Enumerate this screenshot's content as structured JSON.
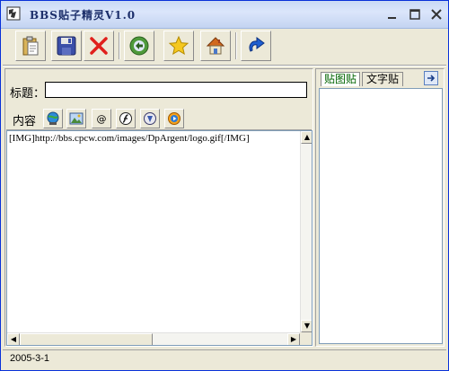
{
  "window": {
    "title": "BBS贴子精灵V1.0"
  },
  "toolbar": {
    "buttons": [
      {
        "name": "clipboard-paste",
        "icon": "clipboard-icon"
      },
      {
        "name": "save",
        "icon": "floppy-disk-icon"
      },
      {
        "name": "delete",
        "icon": "red-x-icon"
      },
      {
        "name": "go",
        "icon": "green-arrow-circle-icon"
      },
      {
        "name": "favorite",
        "icon": "star-icon"
      },
      {
        "name": "home",
        "icon": "house-icon"
      },
      {
        "name": "redo",
        "icon": "blue-redo-arrow-icon"
      }
    ]
  },
  "form": {
    "title_label": "标题：",
    "title_value": "",
    "content_label": "内容"
  },
  "insert_buttons": [
    {
      "name": "insert-link",
      "icon": "globe-link-icon"
    },
    {
      "name": "insert-image",
      "icon": "picture-icon"
    },
    {
      "name": "insert-email",
      "icon": "at-sign-icon"
    },
    {
      "name": "insert-flash",
      "icon": "flash-icon"
    },
    {
      "name": "insert-realplayer",
      "icon": "realplayer-icon"
    },
    {
      "name": "insert-media",
      "icon": "media-player-icon"
    }
  ],
  "editor": {
    "content": "[IMG]http://bbs.cpcw.com/images/DpArgent/logo.gif[/IMG]"
  },
  "side_tabs": [
    {
      "label": "贴图贴",
      "active": true
    },
    {
      "label": "文字贴",
      "active": false
    }
  ],
  "status": {
    "date": "2005-3-1"
  },
  "colors": {
    "face": "#ece9d8",
    "title_gradient_top": "#c9d9f5",
    "input_border": "#7f9db9",
    "active_tab_text": "#006400"
  }
}
